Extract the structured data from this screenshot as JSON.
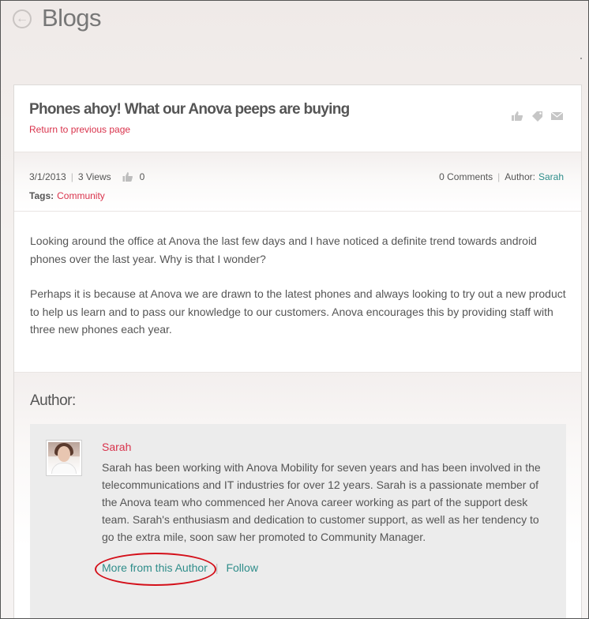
{
  "page": {
    "title": "Blogs",
    "back_icon": "back-arrow-circle-icon"
  },
  "post": {
    "title": "Phones ahoy! What our Anova peeps are buying",
    "return_link": "Return to previous page",
    "actions": [
      {
        "name": "like-icon"
      },
      {
        "name": "tag-icon"
      },
      {
        "name": "email-icon"
      }
    ],
    "meta": {
      "date": "3/1/2013",
      "views": "3 Views",
      "likes": "0",
      "comments": "0 Comments",
      "author_label": "Author:",
      "author_name": "Sarah",
      "tags_label": "Tags:",
      "tag": "Community"
    },
    "body": [
      "Looking around the office at Anova the last few days and I have noticed a definite trend towards android phones over the last year. Why is that I wonder?",
      "Perhaps it is because at Anova we are drawn to the latest phones and always looking to try out a new product to help us learn and to pass our knowledge to our customers. Anova encourages this by providing staff with three new phones each year."
    ]
  },
  "author": {
    "heading": "Author:",
    "name": "Sarah",
    "bio": "Sarah has been working with Anova Mobility for seven years and has been involved in the telecommunications and IT industries for over 12 years. Sarah is a passionate member of the Anova team who commenced her Anova career working as part of the support desk team. Sarah's enthusiasm and dedication to customer support, as well as her tendency to go the extra mile, soon saw her promoted to Community Manager.",
    "more_link": "More from this Author",
    "follow_link": "Follow"
  },
  "colors": {
    "accent_red": "#d9334c",
    "accent_teal": "#2e8d8a",
    "annotation_red": "#d4101a"
  }
}
